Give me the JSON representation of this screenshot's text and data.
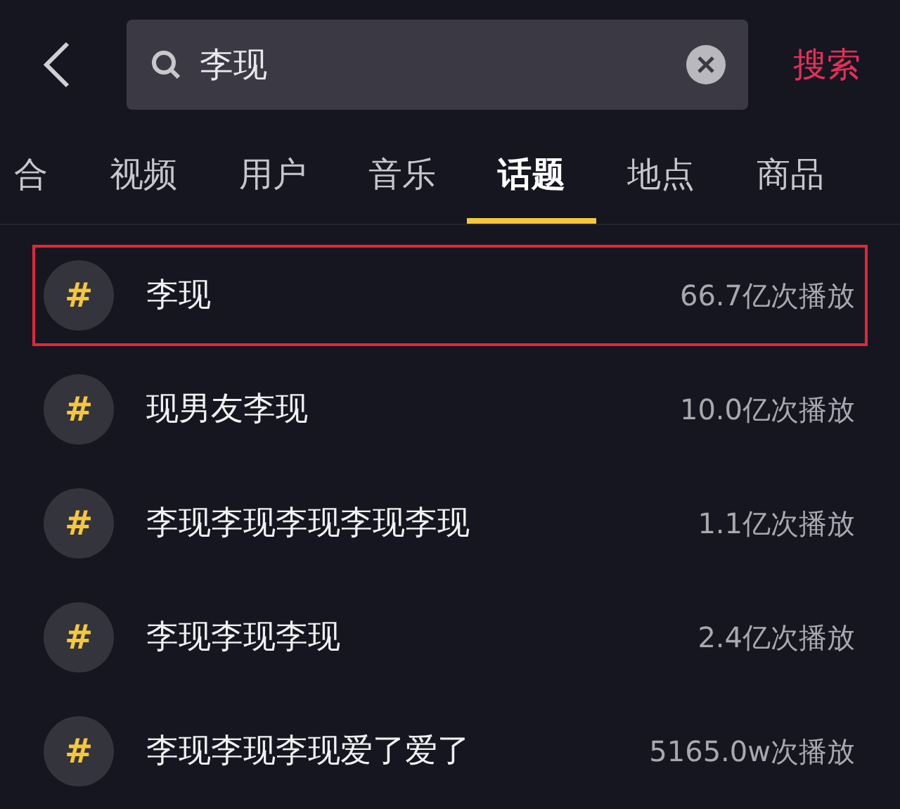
{
  "search": {
    "value": "李现",
    "action": "搜索"
  },
  "tabs": [
    {
      "label": "合",
      "selected": false
    },
    {
      "label": "视频",
      "selected": false
    },
    {
      "label": "用户",
      "selected": false
    },
    {
      "label": "音乐",
      "selected": false
    },
    {
      "label": "话题",
      "selected": true
    },
    {
      "label": "地点",
      "selected": false
    },
    {
      "label": "商品",
      "selected": false
    }
  ],
  "topics": [
    {
      "icon": "#",
      "title": "李现",
      "plays": "66.7亿次播放",
      "highlighted": true
    },
    {
      "icon": "#",
      "title": "现男友李现",
      "plays": "10.0亿次播放",
      "highlighted": false
    },
    {
      "icon": "#",
      "title": "李现李现李现李现李现",
      "plays": "1.1亿次播放",
      "highlighted": false
    },
    {
      "icon": "#",
      "title": "李现李现李现",
      "plays": "2.4亿次播放",
      "highlighted": false
    },
    {
      "icon": "#",
      "title": "李现李现李现爱了爱了",
      "plays": "5165.0w次播放",
      "highlighted": false
    }
  ]
}
